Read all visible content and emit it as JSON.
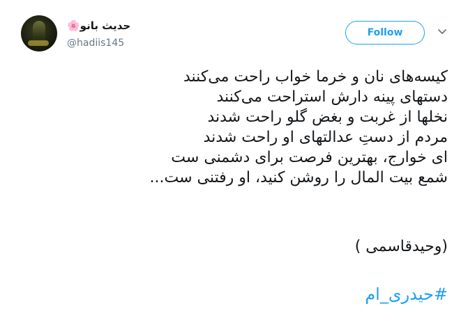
{
  "user": {
    "display_name": "حدیث بانو🌸",
    "handle": "@hadiis145"
  },
  "actions": {
    "follow_label": "Follow",
    "menu_icon": "chevron-down-icon"
  },
  "tweet": {
    "lines": [
      "کیسه‌های نان و خرما خواب راحت می‌کنند",
      "دستهای پینه دارش استراحت می‌کنند",
      "نخلها از غربت و بغض گلو راحت شدند",
      "مردم از دستِ عدالتهای او راحت شدند",
      "ای خوارج، بهترین فرصت برای دشمنی ست",
      "شمع بیت المال را روشن کنید، او رفتنی ست..."
    ],
    "signature": "(وحیدقاسمی )",
    "hashtag": "#حیدری_ام"
  },
  "colors": {
    "accent": "#1da1f2",
    "text": "#14171a",
    "muted": "#657786"
  }
}
